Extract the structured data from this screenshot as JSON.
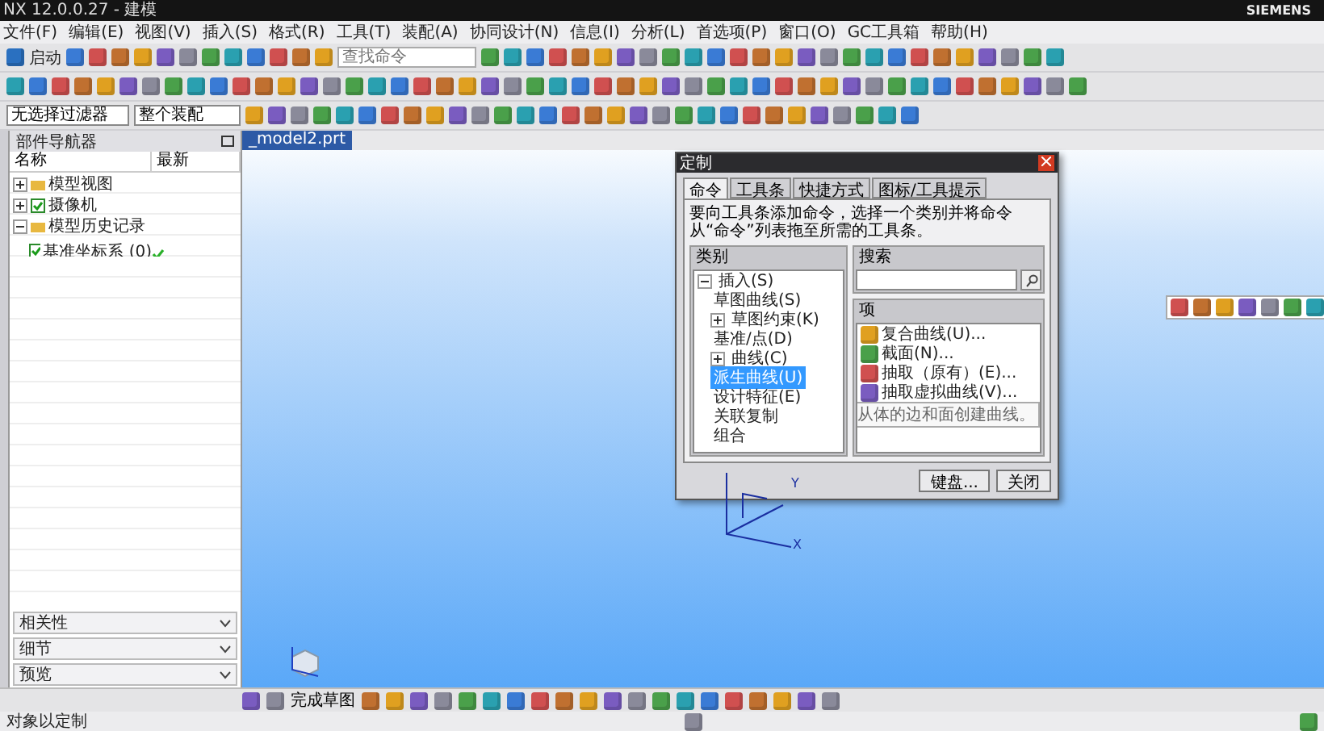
{
  "window": {
    "title": "NX 12.0.0.27 - 建模",
    "brand": "SIEMENS"
  },
  "menu": [
    "文件(F)",
    "编辑(E)",
    "视图(V)",
    "插入(S)",
    "格式(R)",
    "工具(T)",
    "装配(A)",
    "协同设计(N)",
    "信息(I)",
    "分析(L)",
    "首选项(P)",
    "窗口(O)",
    "GC工具箱",
    "帮助(H)"
  ],
  "toolbar": {
    "start_label": "启动",
    "search": {
      "placeholder": "查找命令"
    }
  },
  "filters": [
    "无选择过滤器",
    "整个装配"
  ],
  "navigator": {
    "title": "部件导航器",
    "columns": [
      "名称",
      "最新"
    ],
    "items": [
      {
        "label": "模型视图",
        "expanded": false,
        "checked": false
      },
      {
        "label": "摄像机",
        "expanded": false,
        "checked": true
      },
      {
        "label": "模型历史记录",
        "expanded": true,
        "checked": false,
        "children": [
          {
            "label": "基准坐标系 (0)",
            "checked": true,
            "up_to_date": true
          }
        ]
      }
    ],
    "panels": [
      "相关性",
      "细节",
      "预览"
    ]
  },
  "document_tab": {
    "label": "_model2.prt"
  },
  "dialog": {
    "title": "定制",
    "tabs": [
      {
        "label": "命令",
        "selected": true
      },
      {
        "label": "工具条",
        "selected": false
      },
      {
        "label": "快捷方式",
        "selected": false
      },
      {
        "label": "图标/工具提示",
        "selected": false
      }
    ],
    "instruction": "要向工具条添加命令，选择一个类别并将命令从“命令”列表拖至所需的工具条。",
    "category_label": "类别",
    "categories": [
      {
        "label": "插入(S)",
        "expanded": true,
        "selected": false,
        "children": [
          {
            "label": "草图曲线(S)",
            "selected": false
          },
          {
            "label": "草图约束(K)",
            "expanded": false,
            "selected": false
          },
          {
            "label": "基准/点(D)",
            "selected": false
          },
          {
            "label": "曲线(C)",
            "expanded": false,
            "selected": false
          },
          {
            "label": "派生曲线(U)",
            "selected": true
          },
          {
            "label": "设计特征(E)",
            "selected": false
          },
          {
            "label": "关联复制",
            "selected": false
          },
          {
            "label": "组合",
            "selected": false
          }
        ]
      }
    ],
    "search_label": "搜索",
    "items_label": "项",
    "commands": [
      "复合曲线(U)...",
      "截面(N)...",
      "抽取（原有）(E)...",
      "抽取虚拟曲线(V)..."
    ],
    "tooltip": "从体的边和面创建曲线。",
    "buttons": [
      "键盘...",
      "关闭"
    ]
  },
  "axes": [
    "Y",
    "X"
  ],
  "sketch_toolbar": {
    "finish_label": "完成草图"
  },
  "status_bar": "对象以定制"
}
